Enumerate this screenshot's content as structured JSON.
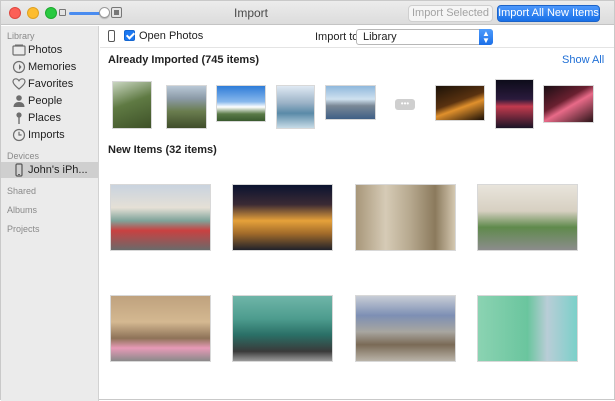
{
  "window": {
    "title": "Import"
  },
  "toolbar": {
    "import_selected": "Import Selected",
    "import_all": "Import All New Items"
  },
  "sidebar": {
    "sections": {
      "library": "Library",
      "devices": "Devices",
      "shared": "Shared",
      "albums": "Albums",
      "projects": "Projects"
    },
    "library_items": [
      {
        "label": "Photos",
        "icon": "photos-icon"
      },
      {
        "label": "Memories",
        "icon": "memories-icon"
      },
      {
        "label": "Favorites",
        "icon": "heart-icon"
      },
      {
        "label": "People",
        "icon": "person-icon"
      },
      {
        "label": "Places",
        "icon": "pin-icon"
      },
      {
        "label": "Imports",
        "icon": "clock-icon"
      }
    ],
    "device": {
      "label": "John's iPh...",
      "icon": "iphone-icon"
    }
  },
  "main": {
    "open_photos_label": "Open Photos",
    "import_to_label": "Import to:",
    "import_to_value": "Library",
    "already_imported_title": "Already Imported (745 items)",
    "show_all": "Show All",
    "new_items_title": "New Items (32 items)"
  },
  "colors": {
    "accent": "#1b78f2",
    "link": "#1f6fd6",
    "sidebar_bg": "#ebebeb",
    "selected_bg": "#cfcfcf"
  }
}
